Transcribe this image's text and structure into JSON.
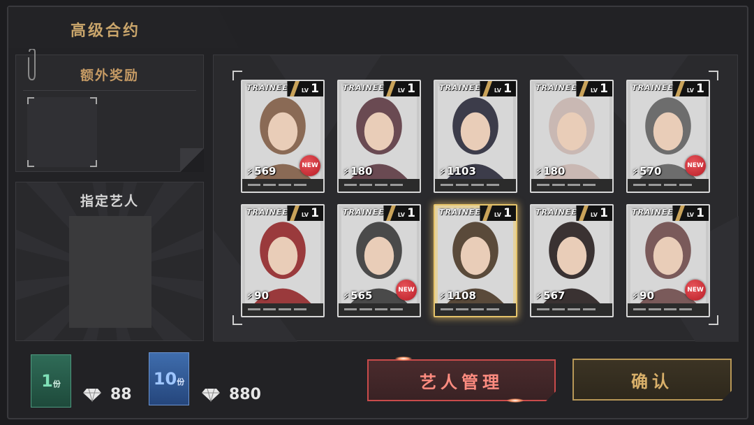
{
  "header": {
    "title": "高级合约"
  },
  "bonus": {
    "title": "额外奖励"
  },
  "designated_artist": {
    "title": "指定艺人"
  },
  "card_labels": {
    "series": "TRAINEE",
    "lv_label": "LV",
    "new_label": "NEW"
  },
  "cards": [
    {
      "level": "1",
      "power": "569",
      "is_new": true,
      "highlight": false,
      "tone": "#8a6a55"
    },
    {
      "level": "1",
      "power": "180",
      "is_new": false,
      "highlight": false,
      "tone": "#6a4a52"
    },
    {
      "level": "1",
      "power": "1103",
      "is_new": false,
      "highlight": false,
      "tone": "#3c3c4a"
    },
    {
      "level": "1",
      "power": "180",
      "is_new": false,
      "highlight": false,
      "tone": "#c9b8b3"
    },
    {
      "level": "1",
      "power": "570",
      "is_new": true,
      "highlight": false,
      "tone": "#6d6d6d"
    },
    {
      "level": "1",
      "power": "90",
      "is_new": false,
      "highlight": false,
      "tone": "#9a3a3c"
    },
    {
      "level": "1",
      "power": "565",
      "is_new": true,
      "highlight": false,
      "tone": "#4a4a4a"
    },
    {
      "level": "1",
      "power": "1108",
      "is_new": false,
      "highlight": true,
      "tone": "#5a4a3a"
    },
    {
      "level": "1",
      "power": "567",
      "is_new": false,
      "highlight": false,
      "tone": "#3a3232"
    },
    {
      "level": "1",
      "power": "90",
      "is_new": true,
      "highlight": false,
      "tone": "#7a5a5a"
    }
  ],
  "packs": [
    {
      "count": "1",
      "unit": "份",
      "cost": "88"
    },
    {
      "count": "10",
      "unit": "份",
      "cost": "880"
    }
  ],
  "buttons": {
    "manage": "艺人管理",
    "confirm": "确认"
  },
  "icons": {
    "pack_cost_icon": "diamond-icon",
    "bonus_clip_icon": "paperclip-icon"
  },
  "colors": {
    "accent_gold": "#c9a56b",
    "accent_red": "#c94b4b",
    "pack1": "#2f6b57",
    "pack10": "#3f6dad"
  }
}
